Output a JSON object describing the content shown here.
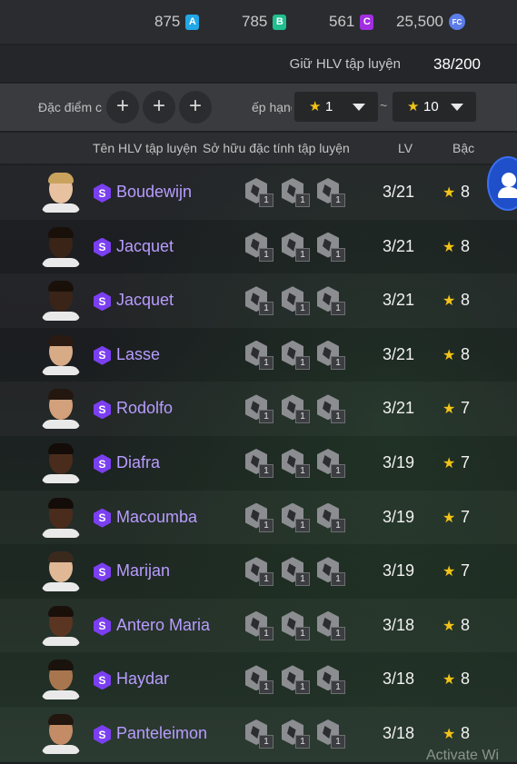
{
  "currencies": [
    {
      "value": "875",
      "tag": "A",
      "color": "#22a7e8"
    },
    {
      "value": "785",
      "tag": "B",
      "color": "#1fbf8e"
    },
    {
      "value": "561",
      "tag": "C",
      "color": "#a12fe0"
    },
    {
      "value": "25,500",
      "tag": "FC",
      "color": "#5c7de8"
    }
  ],
  "keep": {
    "label": "Giữ HLV tập luyện",
    "count": "38/200"
  },
  "filter": {
    "traits_label": "Đặc điểm c",
    "rank_label": "ếp hạng",
    "rank_min": "1",
    "rank_max": "10",
    "tilde": "~",
    "plus": "+"
  },
  "header": {
    "name": "Tên HLV tập luyện",
    "traits": "Sở hữu đặc tính tập luyện",
    "lv": "LV",
    "rank": "Bậc"
  },
  "badge_letter": "S",
  "star": "★",
  "trait_level": "1",
  "rows": [
    {
      "name": "Boudewijn",
      "lv": "3/21",
      "rank": "8",
      "skin": "#e8c2a0",
      "hair": "#c9a35e"
    },
    {
      "name": "Jacquet",
      "lv": "3/21",
      "rank": "8",
      "skin": "#3a2418",
      "hair": "#1a100a"
    },
    {
      "name": "Jacquet",
      "lv": "3/21",
      "rank": "8",
      "skin": "#3a2418",
      "hair": "#1a100a"
    },
    {
      "name": "Lasse",
      "lv": "3/21",
      "rank": "8",
      "skin": "#d8ab87",
      "hair": "#2a1a12"
    },
    {
      "name": "Rodolfo",
      "lv": "3/21",
      "rank": "7",
      "skin": "#d2a07a",
      "hair": "#241710"
    },
    {
      "name": "Diafra",
      "lv": "3/19",
      "rank": "7",
      "skin": "#4a2c1c",
      "hair": "#140c08"
    },
    {
      "name": "Macoumba",
      "lv": "3/19",
      "rank": "7",
      "skin": "#4a2c1c",
      "hair": "#140c08"
    },
    {
      "name": "Marijan",
      "lv": "3/19",
      "rank": "7",
      "skin": "#e0b896",
      "hair": "#3a2a1e"
    },
    {
      "name": "Antero Maria",
      "lv": "3/18",
      "rank": "8",
      "skin": "#5a3622",
      "hair": "#1a100a"
    },
    {
      "name": "Haydar",
      "lv": "3/18",
      "rank": "8",
      "skin": "#a8764e",
      "hair": "#1a120c"
    },
    {
      "name": "Panteleimon",
      "lv": "3/18",
      "rank": "8",
      "skin": "#c48c66",
      "hair": "#22160e"
    }
  ],
  "watermark": "Activate Wi"
}
